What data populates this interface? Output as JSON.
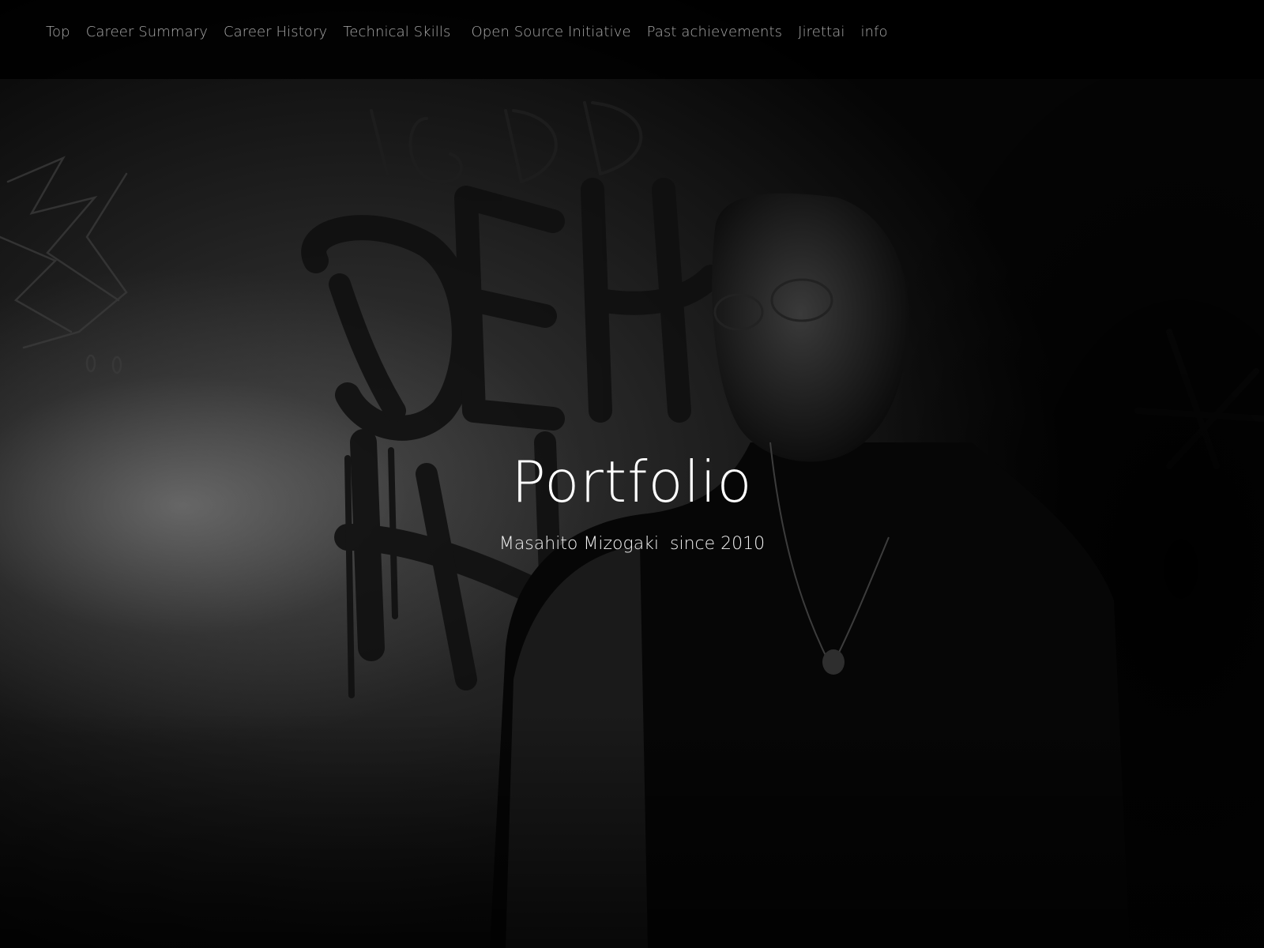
{
  "nav": {
    "items": [
      {
        "label": "Top"
      },
      {
        "label": "Career Summary"
      },
      {
        "label": "Career History"
      },
      {
        "label": "Technical Skills"
      },
      {
        "label": "Open Source Initiative"
      },
      {
        "label": "Past achievements"
      },
      {
        "label": "Jirettai"
      },
      {
        "label": "info"
      }
    ]
  },
  "hero": {
    "title": "Portfolio",
    "subtitle": "Masahito Mizogaki  since 2010"
  }
}
